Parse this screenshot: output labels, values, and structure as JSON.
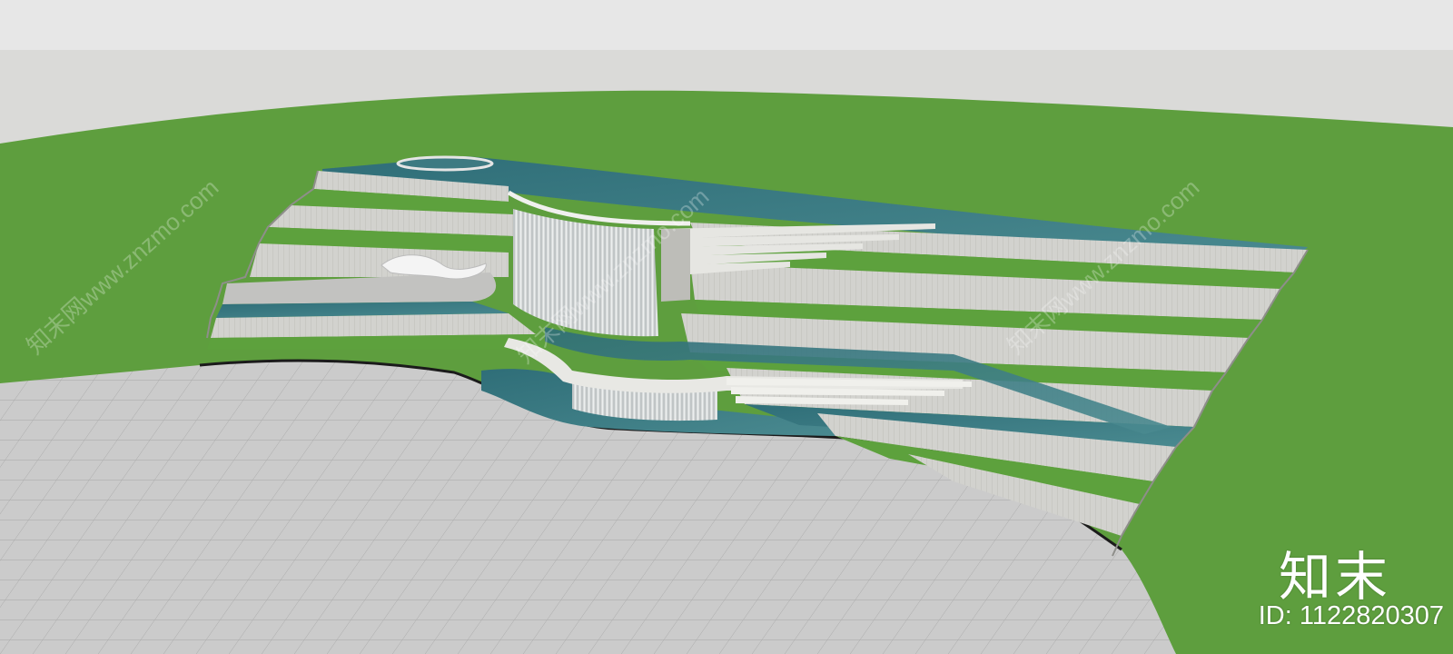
{
  "watermark": {
    "logo": "知末",
    "id_text": "ID: 1122820307",
    "repeat_text": "知末网www.znzmo.com"
  },
  "colors": {
    "sky": "#dcdcdc",
    "lawn": "#5f9f3e",
    "paving": "#c9c9c9",
    "water": "#3d7a82",
    "wall": "#cfcfcb",
    "terrace_green": "#5da13d"
  }
}
